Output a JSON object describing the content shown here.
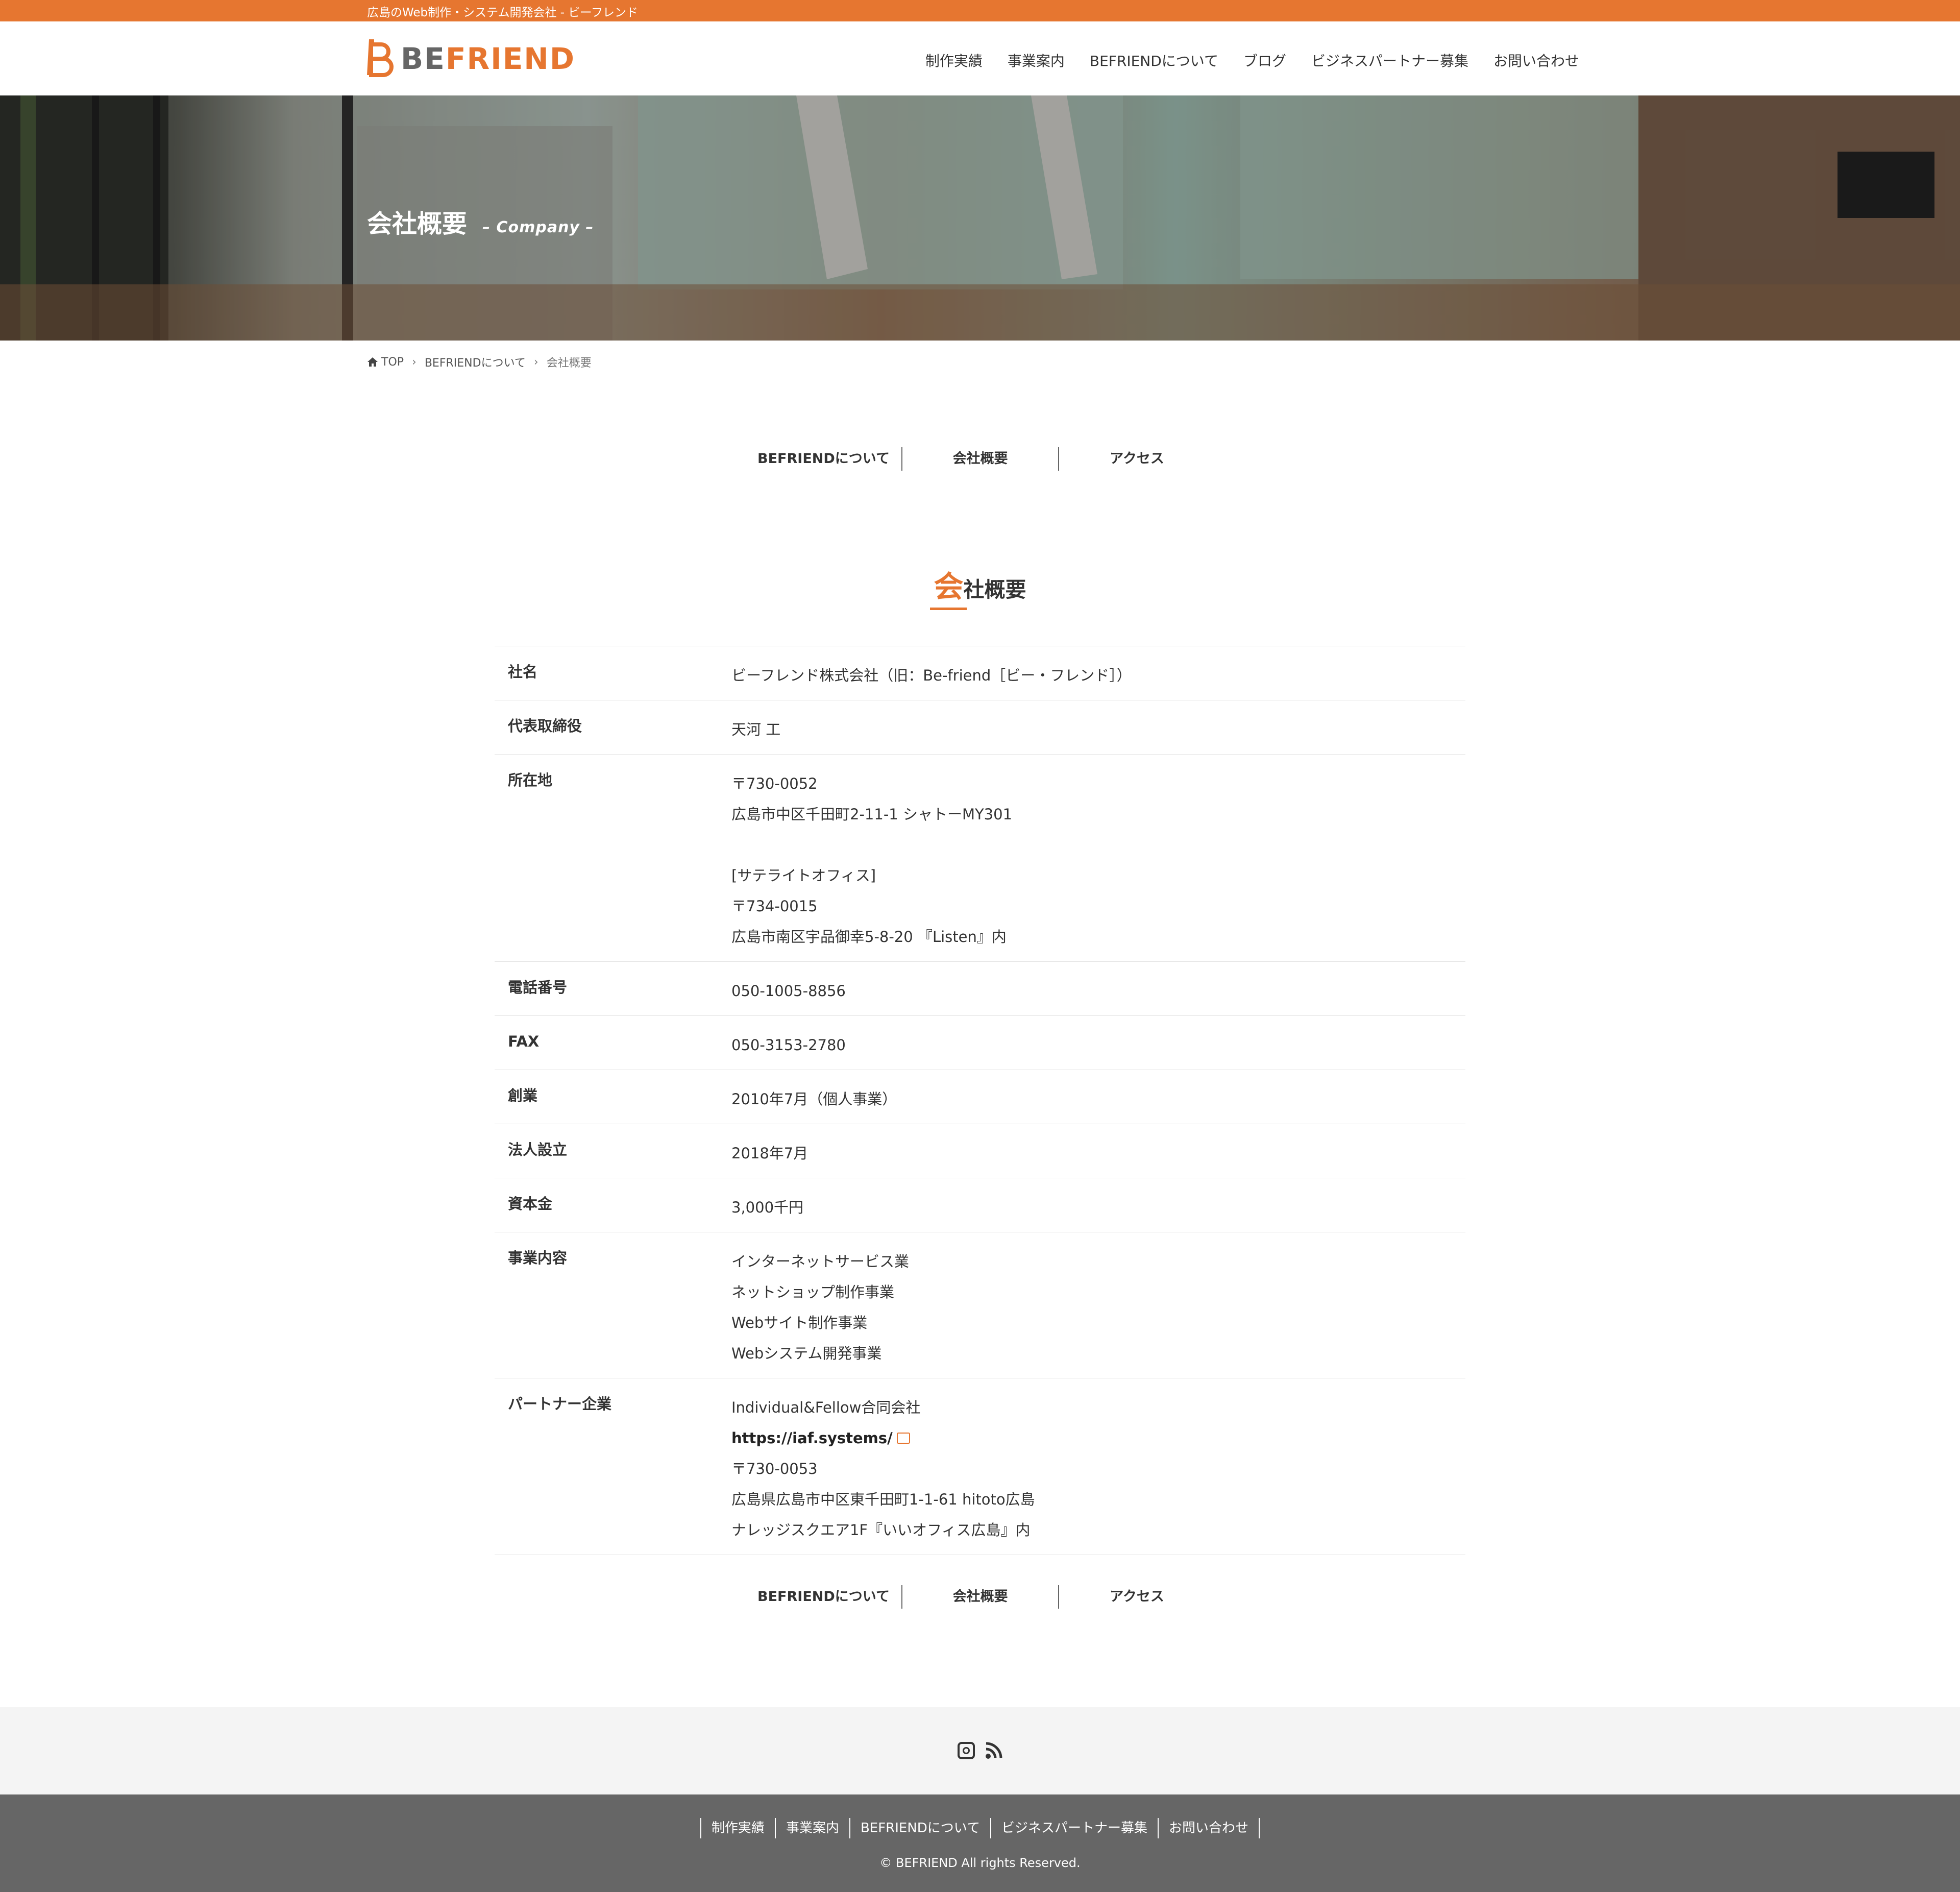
{
  "topbar": {
    "tagline": "広島のWeb制作・システム開発会社 - ビーフレンド"
  },
  "header": {
    "logo_be": "BE",
    "logo_friend": "FRIEND",
    "nav": [
      "制作実績",
      "事業案内",
      "BEFRIENDについて",
      "ブログ",
      "ビジネスパートナー募集",
      "お問い合わせ"
    ]
  },
  "hero": {
    "title": "会社概要",
    "subtitle": "– Company –"
  },
  "breadcrumb": {
    "home": "TOP",
    "parent": "BEFRIENDについて",
    "current": "会社概要"
  },
  "subnav": [
    "BEFRIENDについて",
    "会社概要",
    "アクセス"
  ],
  "section": {
    "heading_first": "会",
    "heading_rest": "社概要"
  },
  "company": {
    "name_label": "社名",
    "name": "ビーフレンド株式会社（旧：Be-friend［ビー・フレンド］）",
    "ceo_label": "代表取締役",
    "ceo": "天河 工",
    "address_label": "所在地",
    "address": [
      "〒730-0052",
      "広島市中区千田町2-11-1 シャトーMY301",
      "",
      "[サテライトオフィス]",
      "〒734-0015",
      "広島市南区宇品御幸5-8-20 『Listen』内"
    ],
    "tel_label": "電話番号",
    "tel": "050-1005-8856",
    "fax_label": "FAX",
    "fax": "050-3153-2780",
    "founded_label": "創業",
    "founded": "2010年7月（個人事業）",
    "incorporated_label": "法人設立",
    "incorporated": "2018年7月",
    "capital_label": "資本金",
    "capital": "3,000千円",
    "business_label": "事業内容",
    "business": [
      "インターネットサービス業",
      "ネットショップ制作事業",
      "Webサイト制作事業",
      "Webシステム開発事業"
    ],
    "partner_label": "パートナー企業",
    "partner_name": "Individual&Fellow合同会社",
    "partner_url": "https://iaf.systems/",
    "partner_address": [
      "〒730-0053",
      "広島県広島市中区東千田町1-1-61 hitoto広島",
      "ナレッジスクエア1F『いいオフィス広島』内"
    ]
  },
  "footer": {
    "links": [
      "制作実績",
      "事業案内",
      "BEFRIENDについて",
      "ビジネスパートナー募集",
      "お問い合わせ"
    ],
    "copyright": "© BEFRIEND All rights Reserved."
  },
  "colors": {
    "accent": "#e67630",
    "footer_bg": "#666666",
    "social_bg": "#f4f4f4"
  },
  "icons": [
    "home-icon",
    "chevron-right-icon",
    "external-link-icon",
    "instagram-icon",
    "rss-icon"
  ]
}
